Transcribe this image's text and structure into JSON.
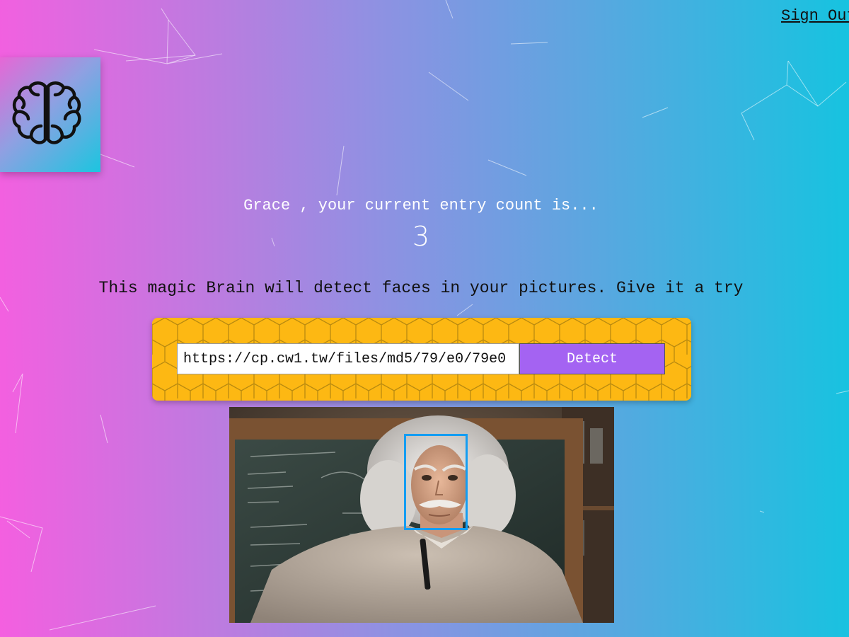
{
  "nav": {
    "sign_out_label": "Sign Out"
  },
  "logo": {
    "icon": "brain-icon"
  },
  "rank": {
    "name_line": "Grace , your current entry count is...",
    "count": "3"
  },
  "tagline": "This magic Brain will detect faces in your pictures. Give it a try",
  "form": {
    "url_value": "https://cp.cw1.tw/files/md5/79/e0/79e0",
    "detect_label": "Detect"
  },
  "image": {
    "subject": "person-portrait",
    "faces_detected": 1
  },
  "colors": {
    "gradient_start": "#f45fe0",
    "gradient_end": "#16c3e0",
    "panel_yellow": "#fdb813",
    "button_purple": "#a463f2",
    "face_box_blue": "#149df2"
  }
}
